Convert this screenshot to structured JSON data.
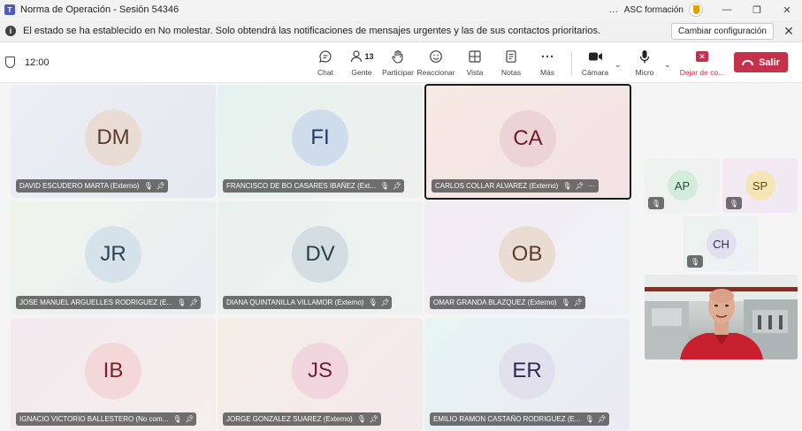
{
  "window": {
    "title": "Norma de Operación - Sesión 54346",
    "account": "ASC formación",
    "more_icon": "…",
    "minimize": "—",
    "restore": "❐",
    "close": "✕"
  },
  "notification": {
    "message": "El estado se ha establecido en No molestar. Solo obtendrá las notificaciones de mensajes urgentes y las de sus contactos prioritarios.",
    "action_label": "Cambiar configuración",
    "close_icon": "✕"
  },
  "toolbar": {
    "timer": "12:00",
    "buttons": [
      {
        "label": "Chat",
        "icon": "chat-icon"
      },
      {
        "label": "Gente",
        "icon": "people-icon",
        "count": "13"
      },
      {
        "label": "Participar",
        "icon": "raise-hand-icon"
      },
      {
        "label": "Reaccionar",
        "icon": "smile-icon"
      },
      {
        "label": "Vista",
        "icon": "grid-icon"
      },
      {
        "label": "Notas",
        "icon": "notes-icon"
      },
      {
        "label": "Más",
        "icon": "more-icon"
      },
      {
        "label": "Cámara",
        "icon": "camera-icon"
      },
      {
        "label": "Micro",
        "icon": "mic-icon"
      },
      {
        "label": "Dejar de co...",
        "icon": "stop-share-icon"
      }
    ],
    "leave_label": "Salir"
  },
  "participants": [
    {
      "initials": "DM",
      "name": "DAVID ESCUDERO MARTA (Externo)",
      "avatar_bg": "#e9dcd4",
      "avatar_fg": "#5a3b2e",
      "tile_bg": "linear-gradient(135deg,#eceff3,#e4e8ef)"
    },
    {
      "initials": "FI",
      "name": "FRANCISCO DE BO CASARES IBAÑEZ (Ext...",
      "avatar_bg": "#cfdcec",
      "avatar_fg": "#1f3d63",
      "tile_bg": "linear-gradient(135deg,#e6f2ef,#eef0ee)"
    },
    {
      "initials": "CA",
      "name": "CARLOS COLLAR ALVAREZ (Externo)",
      "avatar_bg": "#ecd3d6",
      "avatar_fg": "#6b1d27",
      "tile_bg": "linear-gradient(135deg,#f6eae4,#f2e2e4)"
    },
    {
      "initials": "JR",
      "name": "JOSE MANUEL ARGUELLES RODRIGUEZ (E...",
      "avatar_bg": "#d6e2ea",
      "avatar_fg": "#2c4353",
      "tile_bg": "linear-gradient(135deg,#eef4ea,#e8eef2)"
    },
    {
      "initials": "DV",
      "name": "DIANA QUINTANILLA VILLAMOR (Externo)",
      "avatar_bg": "#d3dde2",
      "avatar_fg": "#27404a",
      "tile_bg": "linear-gradient(135deg,#e9f1ee,#eef2f1)"
    },
    {
      "initials": "OB",
      "name": "OMAR GRANDA BLAZQUEZ (Externo)",
      "avatar_bg": "#ebdcd3",
      "avatar_fg": "#5b3c2b",
      "tile_bg": "linear-gradient(135deg,#f2ecf3,#eef1f4)"
    },
    {
      "initials": "IB",
      "name": "IGNACIO VICTORIO BALLESTERO (No com...",
      "avatar_bg": "#f3d7d9",
      "avatar_fg": "#7a1f2b",
      "tile_bg": "linear-gradient(135deg,#f3e9ef,#f4eeec)"
    },
    {
      "initials": "JS",
      "name": "JORGE GONZALEZ SUAREZ (Externo)",
      "avatar_bg": "#f2d6df",
      "avatar_fg": "#6d1e3a",
      "tile_bg": "linear-gradient(135deg,#f3eee6,#f4e9ec)"
    },
    {
      "initials": "ER",
      "name": "EMILIO RAMON CASTAÑO RODRIGUEZ (E...",
      "avatar_bg": "#e3e0ee",
      "avatar_fg": "#2f2a55",
      "tile_bg": "linear-gradient(135deg,#e6f5f2,#ece9f3)"
    }
  ],
  "side_participants": [
    {
      "initials": "AP",
      "avatar_bg": "#d4ecdb",
      "avatar_fg": "#215233",
      "tile_bg": "linear-gradient(135deg,#eef4ef,#f1f1f3)"
    },
    {
      "initials": "SP",
      "avatar_bg": "#f6e6b6",
      "avatar_fg": "#5e4a0e",
      "tile_bg": "linear-gradient(135deg,#f4e9f0,#efe9f4)"
    },
    {
      "initials": "CH",
      "avatar_bg": "#e2e0ef",
      "avatar_fg": "#2f2a57",
      "tile_bg": "linear-gradient(135deg,#eaf3ef,#eef0f4)"
    }
  ],
  "active_speaker_index": 2
}
